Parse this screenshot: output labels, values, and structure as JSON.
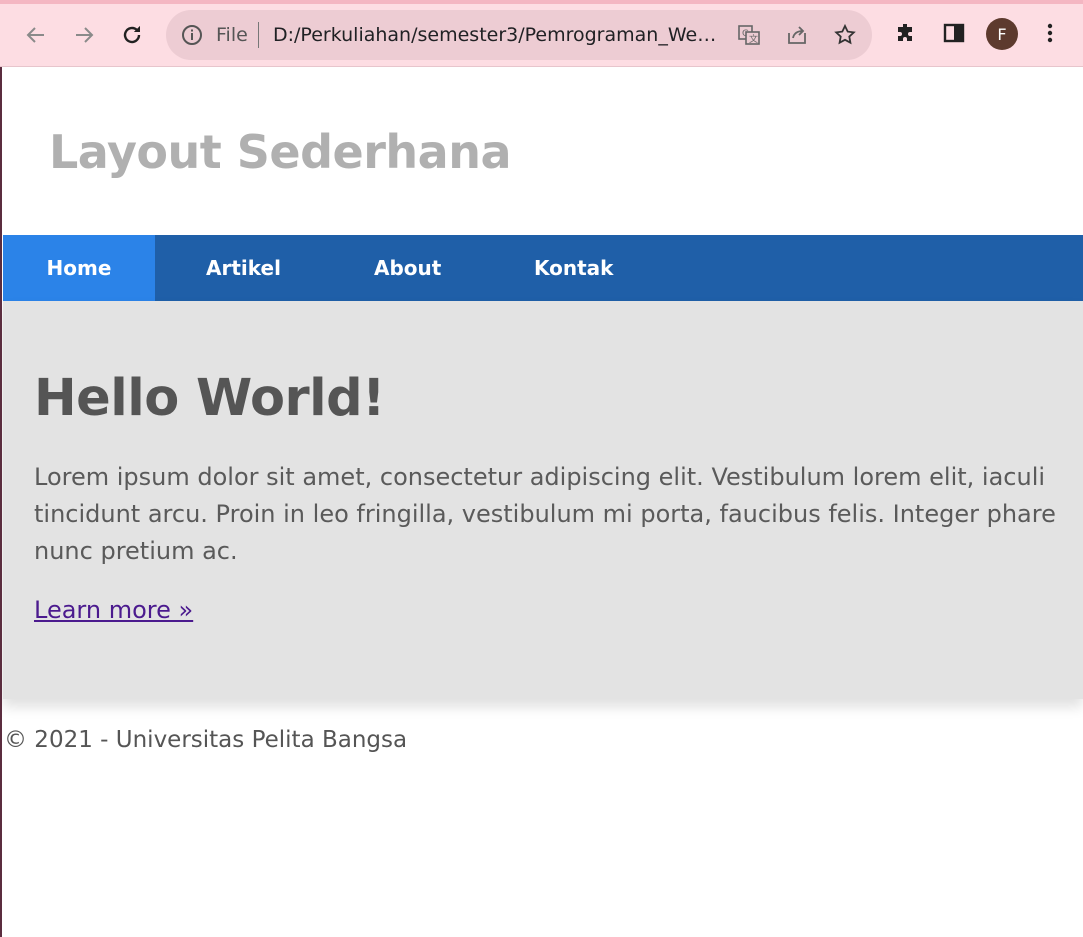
{
  "browser": {
    "scheme": "File",
    "url": "D:/Perkuliahan/semester3/Pemrograman_Web...",
    "profile_initial": "F"
  },
  "site": {
    "title": "Layout Sederhana",
    "nav": [
      "Home",
      "Artikel",
      "About",
      "Kontak"
    ],
    "active_nav": "Home"
  },
  "hero": {
    "heading": "Hello World!",
    "line1": "Lorem ipsum dolor sit amet, consectetur adipiscing elit. Vestibulum lorem elit, iaculi",
    "line2": "tincidunt arcu. Proin in leo fringilla, vestibulum mi porta, faucibus felis. Integer phare",
    "line3": "nunc pretium ac.",
    "link": "Learn more »"
  },
  "footer": {
    "text": "© 2021 - Universitas Pelita Bangsa"
  },
  "colors": {
    "navbar": "#1f5fa8",
    "nav_active": "#2b83e8",
    "hero_bg": "#e3e3e3",
    "chrome_bg": "#fddde3"
  }
}
